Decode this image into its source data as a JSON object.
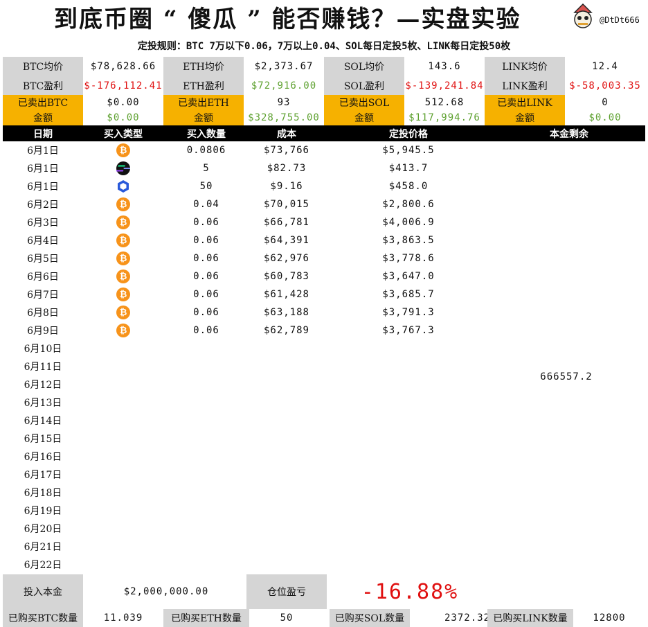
{
  "title": "到底币圈 “ 傻瓜 ” 能否赚钱？—实盘实验",
  "handle": "@DtDt666",
  "logo_icon": "cat-hat-logo-icon",
  "rule": "定投规则：BTC 7万以下0.06，7万以上0.04、SOL每日定投5枚、LINK每日定投50枚",
  "summary": {
    "row1": [
      "BTC均价",
      "$78,628.66",
      "ETH均价",
      "$2,373.67",
      "SOL均价",
      "143.6",
      "LINK均价",
      "12.4"
    ],
    "row2": [
      "BTC盈利",
      "$-176,112.41",
      "ETH盈利",
      "$72,916.00",
      "SOL盈利",
      "$-139,241.84",
      "LINK盈利",
      "$-58,003.35"
    ],
    "row3": [
      "已卖出BTC",
      "$0.00",
      "已卖出ETH",
      "93",
      "已卖出SOL",
      "512.68",
      "已卖出LINK",
      "0"
    ],
    "row4": [
      "金额",
      "$0.00",
      "金额",
      "$328,755.00",
      "金额",
      "$117,994.76",
      "金额",
      "$0.00"
    ]
  },
  "table_headers": [
    "日期",
    "买入类型",
    "买入数量",
    "成本",
    "定投价格",
    "本金剩余"
  ],
  "rows": [
    {
      "date": "6月1日",
      "type": "btc",
      "qty": "0.0806",
      "cost": "$73,766",
      "price": "$5,945.5"
    },
    {
      "date": "6月1日",
      "type": "sol",
      "qty": "5",
      "cost": "$82.73",
      "price": "$413.7"
    },
    {
      "date": "6月1日",
      "type": "link",
      "qty": "50",
      "cost": "$9.16",
      "price": "$458.0"
    },
    {
      "date": "6月2日",
      "type": "btc",
      "qty": "0.04",
      "cost": "$70,015",
      "price": "$2,800.6"
    },
    {
      "date": "6月3日",
      "type": "btc",
      "qty": "0.06",
      "cost": "$66,781",
      "price": "$4,006.9"
    },
    {
      "date": "6月4日",
      "type": "btc",
      "qty": "0.06",
      "cost": "$64,391",
      "price": "$3,863.5"
    },
    {
      "date": "6月5日",
      "type": "btc",
      "qty": "0.06",
      "cost": "$62,976",
      "price": "$3,778.6"
    },
    {
      "date": "6月6日",
      "type": "btc",
      "qty": "0.06",
      "cost": "$60,783",
      "price": "$3,647.0"
    },
    {
      "date": "6月7日",
      "type": "btc",
      "qty": "0.06",
      "cost": "$61,428",
      "price": "$3,685.7"
    },
    {
      "date": "6月8日",
      "type": "btc",
      "qty": "0.06",
      "cost": "$63,188",
      "price": "$3,791.3"
    },
    {
      "date": "6月9日",
      "type": "btc",
      "qty": "0.06",
      "cost": "$62,789",
      "price": "$3,767.3"
    },
    {
      "date": "6月10日"
    },
    {
      "date": "6月11日"
    },
    {
      "date": "6月12日"
    },
    {
      "date": "6月13日"
    },
    {
      "date": "6月14日"
    },
    {
      "date": "6月15日"
    },
    {
      "date": "6月16日"
    },
    {
      "date": "6月17日"
    },
    {
      "date": "6月18日"
    },
    {
      "date": "6月19日"
    },
    {
      "date": "6月20日"
    },
    {
      "date": "6月21日"
    },
    {
      "date": "6月22日"
    }
  ],
  "remaining_principal": "666557.2",
  "bottom": {
    "principal_label": "投入本金",
    "principal_value": "$2,000,000.00",
    "pnl_label": "仓位盈亏",
    "pnl_value": "-16.88%",
    "btc_count_label": "已购买BTC数量",
    "btc_count": "11.039",
    "eth_count_label": "已购买ETH数量",
    "eth_count": "50",
    "sol_count_label": "已购买SOL数量",
    "sol_count": "2372.32",
    "link_count_label": "已购买LINK数量",
    "link_count": "12800"
  },
  "colors": {
    "label_gray": "#d5d5d5",
    "label_gold": "#f6b100",
    "loss_red": "#e01010",
    "gain_green": "#5ea130",
    "btc_orange": "#f7931a",
    "link_blue": "#2a5ada"
  }
}
